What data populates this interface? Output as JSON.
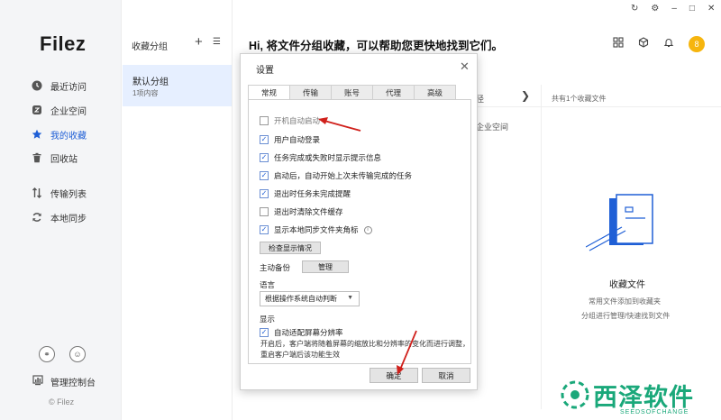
{
  "app": {
    "logo": "Filez",
    "copyright": "© Filez"
  },
  "sidebar": {
    "items": [
      {
        "label": "最近访问",
        "icon": "clock-icon"
      },
      {
        "label": "企业空间",
        "icon": "enterprise-icon"
      },
      {
        "label": "我的收藏",
        "icon": "star-icon",
        "active": true
      },
      {
        "label": "回收站",
        "icon": "trash-icon"
      },
      {
        "label": "传输列表",
        "icon": "transfer-icon"
      },
      {
        "label": "本地同步",
        "icon": "sync-icon"
      }
    ],
    "console_label": "管理控制台"
  },
  "groups": {
    "title": "收藏分组",
    "items": [
      {
        "name": "默认分组",
        "count": "1项内容"
      }
    ]
  },
  "main": {
    "title": "Hi, 将文件分组收藏，可以帮助您更快地找到它们。",
    "avatar_text": "8",
    "behind_label_1": "径",
    "behind_label_2": "企业空间",
    "right_panel_title": "共有1个收藏文件",
    "empty_title": "收藏文件",
    "empty_desc_1": "常用文件添加到收藏夹",
    "empty_desc_2": "分组进行管理/快速找到文件"
  },
  "dialog": {
    "title": "设置",
    "tabs": [
      "常规",
      "传输",
      "账号",
      "代理",
      "高级"
    ],
    "active_tab": 0,
    "options": [
      {
        "label": "开机自动启动",
        "checked": false,
        "dim": true
      },
      {
        "label": "用户自动登录",
        "checked": true
      },
      {
        "label": "任务完成或失败时显示提示信息",
        "checked": true
      },
      {
        "label": "启动后，自动开始上次未传输完成的任务",
        "checked": true
      },
      {
        "label": "退出时任务未完成提醒",
        "checked": true
      },
      {
        "label": "退出时清除文件缓存",
        "checked": false
      },
      {
        "label": "显示本地同步文件夹角标",
        "checked": true
      }
    ],
    "check_display_button": "检查显示情况",
    "backup_label": "主动备份",
    "manage_button": "管理",
    "language_label": "语言",
    "language_value": "根据操作系统自动判断",
    "display_label": "显示",
    "dpi_option": {
      "label": "自动适配屏幕分辨率",
      "checked": true
    },
    "note": "开启后，客户端将随着屏幕的缩放比和分辨率的变化而进行调整，重启客户端后该功能生效",
    "ok_button": "确定",
    "cancel_button": "取消"
  },
  "watermark": {
    "text": "西泽软件",
    "sub": "SEEDSOFCHANGE"
  },
  "colors": {
    "accent": "#1f5fd6",
    "annotation": "#d0201b",
    "watermark": "#1aa87a",
    "avatar": "#f6b50e"
  }
}
